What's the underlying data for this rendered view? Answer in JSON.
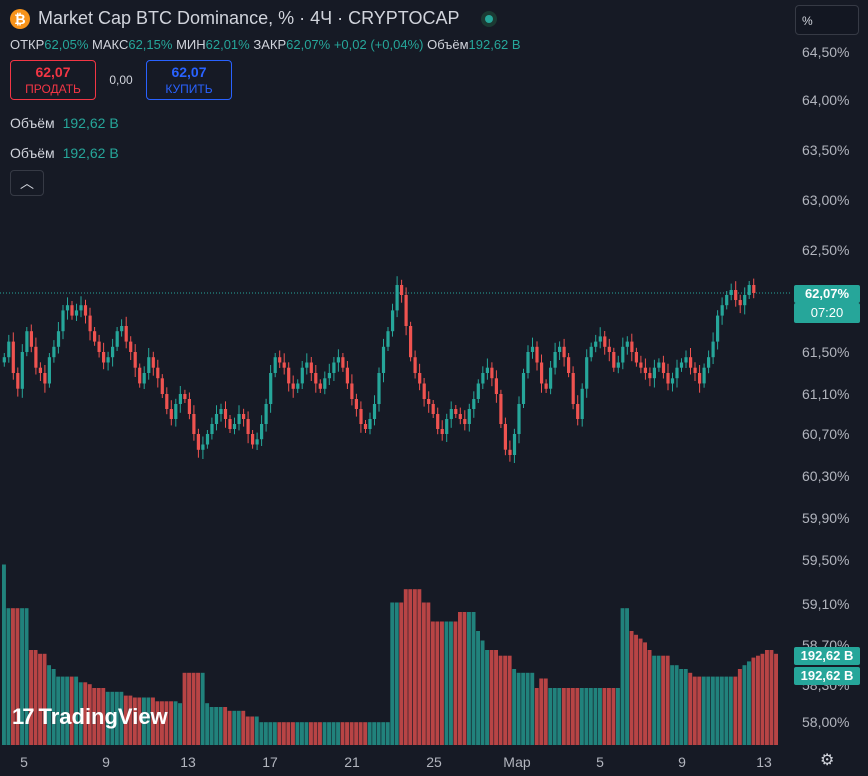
{
  "header": {
    "title": "Market Cap BTC Dominance, % · 4Ч · CRYPTOCAP",
    "btc_symbol": "₿",
    "ohlc": {
      "open_label": "ОТКР",
      "open": "62,05%",
      "high_label": "МАКС",
      "high": "62,15%",
      "low_label": "МИН",
      "low": "62,01%",
      "close_label": "ЗАКР",
      "close": "62,07%",
      "change": "+0,02 (+0,04%)",
      "volume_label": "Объём",
      "volume": "192,62 B"
    }
  },
  "trade": {
    "sell_price": "62,07",
    "sell_label": "ПРОДАТЬ",
    "spread": "0,00",
    "buy_price": "62,07",
    "buy_label": "КУПИТЬ"
  },
  "indicators": [
    {
      "label": "Объём",
      "value": "192,62 B"
    },
    {
      "label": "Объём",
      "value": "192,62 B"
    }
  ],
  "collapse_icon": "chevron-up-icon",
  "scale_mode": "%",
  "price_labels": {
    "price": "62,07%",
    "timer": "07:20",
    "volume1": "192,62 B",
    "volume2": "192,62 B"
  },
  "logo_text": "TradingView",
  "colors": {
    "up": "#26a69a",
    "down": "#ef5350",
    "background": "#161a25"
  },
  "chart_data": {
    "type": "candlestick",
    "interval": "4Ч",
    "y_ticks": [
      "64,50%",
      "64,00%",
      "63,50%",
      "63,00%",
      "62,50%",
      "62,00%",
      "61,50%",
      "61,10%",
      "60,70%",
      "60,30%",
      "59,90%",
      "59,50%",
      "59,10%",
      "58,70%",
      "58,30%",
      "58,00%"
    ],
    "x_ticks": [
      "5",
      "9",
      "13",
      "17",
      "21",
      "25",
      "Мар",
      "5",
      "9",
      "13"
    ],
    "last_price": 62.07,
    "close_series": [
      61.45,
      61.6,
      61.3,
      61.15,
      61.5,
      61.7,
      61.55,
      61.35,
      61.3,
      61.2,
      61.45,
      61.55,
      61.7,
      61.9,
      61.95,
      61.85,
      61.9,
      61.95,
      61.85,
      61.7,
      61.6,
      61.5,
      61.4,
      61.45,
      61.55,
      61.7,
      61.75,
      61.6,
      61.5,
      61.35,
      61.2,
      61.3,
      61.45,
      61.35,
      61.25,
      61.1,
      60.95,
      60.85,
      61.0,
      61.1,
      61.05,
      60.9,
      60.7,
      60.55,
      60.6,
      60.7,
      60.8,
      60.9,
      60.95,
      60.85,
      60.75,
      60.8,
      60.9,
      60.85,
      60.7,
      60.6,
      60.65,
      60.8,
      61.0,
      61.3,
      61.45,
      61.4,
      61.35,
      61.2,
      61.15,
      61.2,
      61.35,
      61.4,
      61.3,
      61.2,
      61.15,
      61.25,
      61.3,
      61.4,
      61.45,
      61.35,
      61.2,
      61.05,
      60.95,
      60.8,
      60.75,
      60.85,
      61.0,
      61.3,
      61.55,
      61.7,
      61.9,
      62.15,
      62.05,
      61.75,
      61.45,
      61.3,
      61.2,
      61.05,
      61.0,
      60.9,
      60.75,
      60.7,
      60.85,
      60.95,
      60.9,
      60.85,
      60.8,
      60.95,
      61.05,
      61.2,
      61.3,
      61.35,
      61.25,
      61.1,
      60.8,
      60.55,
      60.5,
      60.7,
      61.0,
      61.3,
      61.5,
      61.55,
      61.4,
      61.2,
      61.15,
      61.35,
      61.5,
      61.55,
      61.45,
      61.3,
      61.0,
      60.85,
      61.15,
      61.45,
      61.55,
      61.6,
      61.65,
      61.55,
      61.5,
      61.35,
      61.4,
      61.55,
      61.6,
      61.5,
      61.4,
      61.35,
      61.3,
      61.25,
      61.35,
      61.4,
      61.3,
      61.2,
      61.25,
      61.35,
      61.4,
      61.45,
      61.35,
      61.3,
      61.2,
      61.35,
      61.45,
      61.6,
      61.85,
      61.95,
      62.05,
      62.1,
      62.0,
      61.95,
      62.05,
      62.15,
      62.07
    ],
    "volume_series": [
      0.95,
      0.72,
      0.72,
      0.72,
      0.72,
      0.72,
      0.5,
      0.5,
      0.48,
      0.48,
      0.42,
      0.4,
      0.36,
      0.36,
      0.36,
      0.36,
      0.36,
      0.33,
      0.33,
      0.32,
      0.3,
      0.3,
      0.3,
      0.28,
      0.28,
      0.28,
      0.28,
      0.26,
      0.26,
      0.25,
      0.25,
      0.25,
      0.25,
      0.25,
      0.23,
      0.23,
      0.23,
      0.23,
      0.23,
      0.22,
      0.38,
      0.38,
      0.38,
      0.38,
      0.38,
      0.22,
      0.2,
      0.2,
      0.2,
      0.2,
      0.18,
      0.18,
      0.18,
      0.18,
      0.15,
      0.15,
      0.15,
      0.12,
      0.12,
      0.12,
      0.12,
      0.12,
      0.12,
      0.12,
      0.12,
      0.12,
      0.12,
      0.12,
      0.12,
      0.12,
      0.12,
      0.12,
      0.12,
      0.12,
      0.12,
      0.12,
      0.12,
      0.12,
      0.12,
      0.12,
      0.12,
      0.12,
      0.12,
      0.12,
      0.12,
      0.12,
      0.75,
      0.75,
      0.75,
      0.82,
      0.82,
      0.82,
      0.82,
      0.75,
      0.75,
      0.65,
      0.65,
      0.65,
      0.65,
      0.65,
      0.65,
      0.7,
      0.7,
      0.7,
      0.7,
      0.6,
      0.55,
      0.5,
      0.5,
      0.5,
      0.47,
      0.47,
      0.47,
      0.4,
      0.38,
      0.38,
      0.38,
      0.38,
      0.3,
      0.35,
      0.35,
      0.3,
      0.3,
      0.3,
      0.3,
      0.3,
      0.3,
      0.3,
      0.3,
      0.3,
      0.3,
      0.3,
      0.3,
      0.3,
      0.3,
      0.3,
      0.3,
      0.72,
      0.72,
      0.6,
      0.58,
      0.56,
      0.54,
      0.5,
      0.47,
      0.47,
      0.47,
      0.47,
      0.42,
      0.42,
      0.4,
      0.4,
      0.38,
      0.36,
      0.36,
      0.36,
      0.36,
      0.36,
      0.36,
      0.36,
      0.36,
      0.36,
      0.36,
      0.4,
      0.42,
      0.44,
      0.46,
      0.47,
      0.48,
      0.5,
      0.5,
      0.48
    ]
  }
}
